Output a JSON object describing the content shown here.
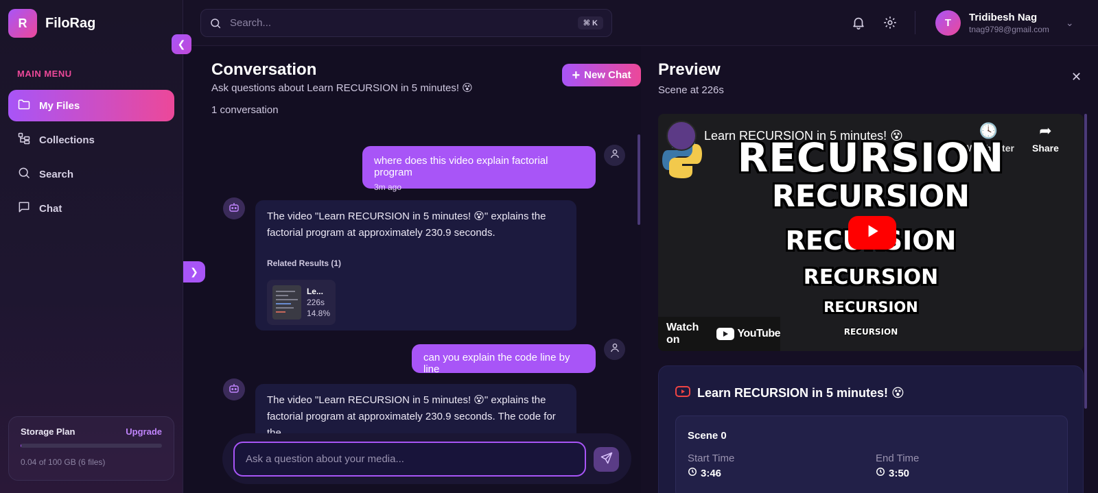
{
  "app": {
    "logo_letter": "R",
    "name": "FiloRag"
  },
  "sidebar": {
    "menu_title": "MAIN MENU",
    "items": [
      {
        "label": "My Files",
        "icon": "folder-icon",
        "active": true
      },
      {
        "label": "Collections",
        "icon": "collections-icon",
        "active": false
      },
      {
        "label": "Search",
        "icon": "search-icon",
        "active": false
      },
      {
        "label": "Chat",
        "icon": "chat-icon",
        "active": false
      }
    ],
    "storage": {
      "title": "Storage Plan",
      "upgrade": "Upgrade",
      "usage_text": "0.04 of 100 GB (6 files)",
      "used_fraction": 0.0004
    }
  },
  "topbar": {
    "search_placeholder": "Search...",
    "shortcut": "⌘ K",
    "user": {
      "initial": "T",
      "name": "Tridibesh Nag",
      "email": "tnag9798@gmail.com"
    }
  },
  "conversation": {
    "title": "Conversation",
    "subtitle": "Ask questions about Learn RECURSION in 5 minutes! 😵",
    "count": "1 conversation",
    "new_chat": "New Chat",
    "messages": [
      {
        "role": "user",
        "text": "where does this video explain factorial program",
        "time": "3m ago"
      },
      {
        "role": "assistant",
        "text": "The video \"Learn RECURSION in 5 minutes! 😵\" explains the factorial program at approximately 230.9 seconds.",
        "related_title": "Related Results (1)",
        "related": {
          "title": "Le...",
          "time": "226s",
          "score": "14.8%"
        }
      },
      {
        "role": "user",
        "text": "can you explain the code line by line"
      },
      {
        "role": "assistant",
        "text": "The video \"Learn RECURSION in 5 minutes! 😵\" explains the factorial program at approximately 230.9 seconds. The code for the"
      }
    ],
    "composer_placeholder": "Ask a question about your media..."
  },
  "preview": {
    "title": "Preview",
    "subtitle": "Scene at 226s",
    "video": {
      "title": "Learn RECURSION in 5 minutes! 😵",
      "watch_later": "Watch later",
      "share": "Share",
      "watch_on": "Watch on",
      "youtube": "YouTube",
      "thumb_words": [
        "RECURSION",
        "RECURSION",
        "RECURSION",
        "RECURSION",
        "RECURSION",
        "RECURSION"
      ]
    },
    "scene": {
      "video_title": "Learn RECURSION in 5 minutes! 😵",
      "name": "Scene 0",
      "start_label": "Start Time",
      "start_value": "3:46",
      "end_label": "End Time",
      "end_value": "3:50"
    }
  },
  "colors": {
    "accent": "#a855f7",
    "accent2": "#ec4899",
    "bubble": "#1c1a3e",
    "youtube_red": "#ff0000"
  }
}
